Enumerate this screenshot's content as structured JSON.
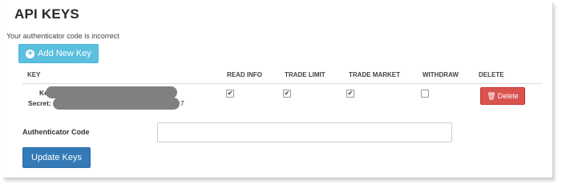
{
  "page": {
    "title": "API KEYS",
    "error_message": "Your authenticator code is incorrect"
  },
  "toolbar": {
    "add_key_label": "Add New Key",
    "add_key_icon": "plus-circle-icon"
  },
  "table": {
    "columns": [
      "KEY",
      "READ INFO",
      "TRADE LIMIT",
      "TRADE MARKET",
      "WITHDRAW",
      "DELETE"
    ],
    "rows": [
      {
        "key_label": "Key:",
        "secret_label": "Secret:",
        "secret_suffix": "7",
        "read_info": true,
        "trade_limit": true,
        "trade_market": true,
        "withdraw": false,
        "delete_label": "Delete",
        "delete_icon": "trash-icon"
      }
    ]
  },
  "form": {
    "auth_label": "Authenticator Code",
    "auth_value": "",
    "update_label": "Update Keys"
  },
  "colors": {
    "info_button": "#5bc0de",
    "danger_button": "#d9534f",
    "primary_button": "#337ab7"
  }
}
